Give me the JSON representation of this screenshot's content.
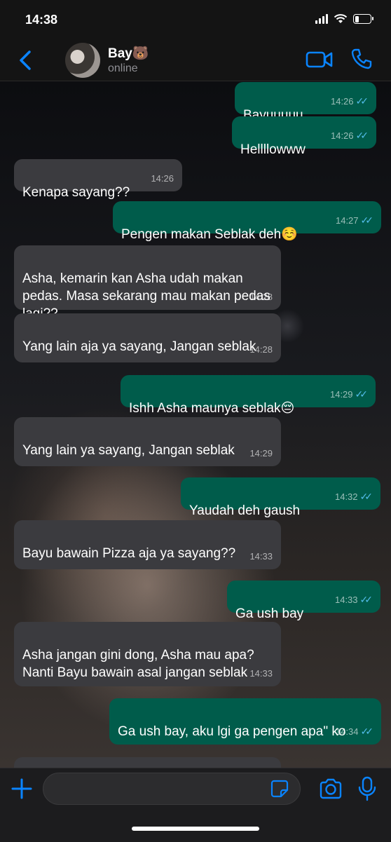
{
  "status": {
    "time": "14:38",
    "battery_level": 0.3
  },
  "header": {
    "contact_name": "Bay🐻",
    "presence": "online",
    "icons": {
      "back": "chevron-left-icon",
      "video": "video-camera-icon",
      "call": "phone-icon"
    },
    "accent_color": "#0a84ff"
  },
  "messages": [
    {
      "direction": "out",
      "text": "Bayuuuuu",
      "time": "14:26",
      "read": true
    },
    {
      "direction": "out",
      "text": "Hellllowww",
      "time": "14:26",
      "read": true
    },
    {
      "direction": "in",
      "text": "Kenapa sayang??",
      "time": "14:26"
    },
    {
      "direction": "out",
      "text": "Pengen makan Seblak deh☺️",
      "time": "14:27",
      "read": true
    },
    {
      "direction": "in",
      "text": "Asha, kemarin kan Asha udah makan pedas. Masa sekarang mau makan pedas lagi??",
      "time": "14:28"
    },
    {
      "direction": "in",
      "text": "Yang lain aja ya sayang, Jangan seblak",
      "time": "14:28"
    },
    {
      "direction": "out",
      "text": "Ishh Asha maunya seblak😔",
      "time": "14:29",
      "read": true
    },
    {
      "direction": "in",
      "text": "Yang lain ya sayang, Jangan seblak",
      "time": "14:29"
    },
    {
      "direction": "out",
      "text": "Yaudah deh gaush",
      "time": "14:32",
      "read": true
    },
    {
      "direction": "in",
      "text": "Bayu bawain Pizza aja ya sayang??",
      "time": "14:33"
    },
    {
      "direction": "out",
      "text": "Ga ush bay",
      "time": "14:33",
      "read": true
    },
    {
      "direction": "in",
      "text": "Asha jangan gini dong, Asha mau apa? Nanti Bayu bawain asal jangan seblak",
      "time": "14:33"
    },
    {
      "direction": "out",
      "text": "Ga ush bay, aku lgi ga pengen apa\" ko",
      "time": "14:34",
      "read": true
    }
  ],
  "composer": {
    "input_value": "",
    "icons": {
      "attach": "plus-icon",
      "sticker": "sticker-icon",
      "camera": "camera-icon",
      "mic": "microphone-icon"
    }
  },
  "colors": {
    "outgoing_bubble": "#005c4b",
    "incoming_bubble": "#3b3b3f",
    "read_tick": "#53bdeb"
  }
}
